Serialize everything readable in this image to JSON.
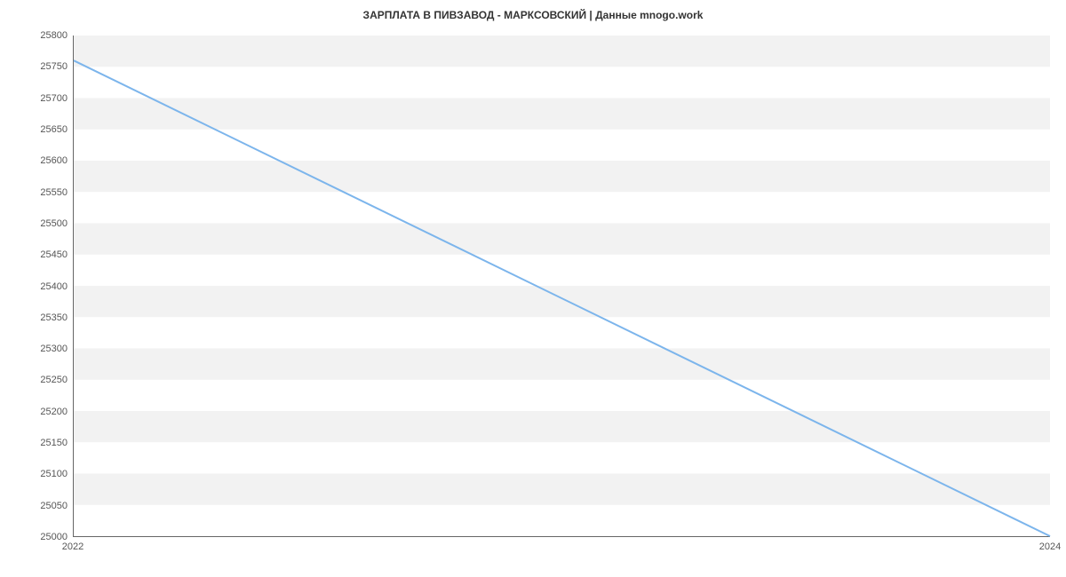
{
  "chart_data": {
    "type": "line",
    "title": "ЗАРПЛАТА В ПИВЗАВОД - МАРКСОВСКИЙ | Данные mnogo.work",
    "xlabel": "",
    "ylabel": "",
    "x": [
      2022,
      2024
    ],
    "values": [
      25760,
      25000
    ],
    "x_ticks": [
      "2022",
      "2024"
    ],
    "y_ticks": [
      "25000",
      "25050",
      "25100",
      "25150",
      "25200",
      "25250",
      "25300",
      "25350",
      "25400",
      "25450",
      "25500",
      "25550",
      "25600",
      "25650",
      "25700",
      "25750",
      "25800"
    ],
    "ylim": [
      25000,
      25800
    ],
    "xlim": [
      2022,
      2024
    ],
    "line_color": "#7cb5ec"
  }
}
